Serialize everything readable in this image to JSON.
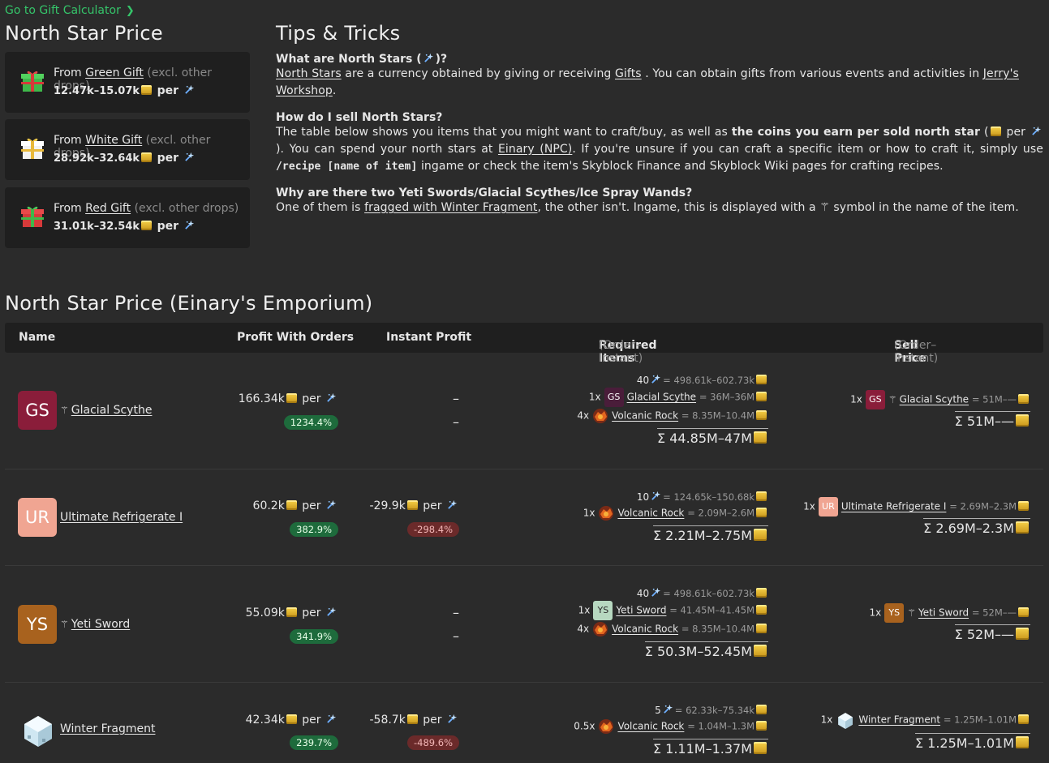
{
  "top_link": "Go to Gift Calculator",
  "left_title": "North Star Price",
  "gifts": [
    {
      "from": "From",
      "name": "Green Gift",
      "excl": "(excl. other drops)",
      "price": "12.47k–15.07k",
      "per": "per",
      "color": "#3fb84a"
    },
    {
      "from": "From",
      "name": "White Gift",
      "excl": "(excl. other drops)",
      "price": "28.92k–32.64k",
      "per": "per",
      "color": "#f2f2f2"
    },
    {
      "from": "From",
      "name": "Red Gift",
      "excl": "(excl. other drops)",
      "price": "31.01k–32.54k",
      "per": "per",
      "color": "#d63a3a"
    }
  ],
  "tips": {
    "title": "Tips & Tricks",
    "q1": "What are North Stars (",
    "q1_end": ")?",
    "a1_link1": "North Stars",
    "a1_t1": " are a currency obtained by giving or receiving ",
    "a1_link2": "Gifts",
    "a1_t2": " . You can obtain gifts from various events and activities in ",
    "a1_link3": "Jerry's Workshop",
    "a1_t3": ".",
    "q2": "How do I sell North Stars?",
    "a2_t1": "The table below shows you items that you might want to craft/buy, as well as ",
    "a2_bold": "the coins you earn per sold north star",
    "a2_t2": " (",
    "a2_per": " per ",
    "a2_t3": "). You can spend your north stars at ",
    "a2_link": "Einary (NPC)",
    "a2_t4": ". If you're unsure if you can craft a specific item or how to craft it, simply use ",
    "a2_code": "/recipe [name of item]",
    "a2_t5": " ingame or check the item's Skyblock Finance and Skyblock Wiki pages for crafting recipes.",
    "q3": "Why are there two Yeti Swords/Glacial Scythes/Ice Spray Wands?",
    "a3_t1": "One of them is ",
    "a3_link": "fragged with Winter Fragment",
    "a3_t2": ", the other isn't. Ingame, this is displayed with a ",
    "a3_sym": "⚚",
    "a3_t3": " symbol in the name of the item."
  },
  "table": {
    "title": "North Star Price (Einary's Emporium)",
    "headers": {
      "name": "Name",
      "profit_orders": "Profit With Orders",
      "instant": "Instant Profit",
      "required": "Required Items",
      "required_sub": "(Order–Instant)",
      "sell": "Sell Price",
      "sell_sub": "(Order–Instant)"
    },
    "per": "per",
    "rows": [
      {
        "abbr": "GS",
        "color": "#8a1d3a",
        "frag": "⚚",
        "name": "Glacial Scythe",
        "profit": "166.34k",
        "profit_pct": "1234.4%",
        "instant": "–",
        "instant_pct": "–",
        "stars": "40",
        "stars_price": "= 498.61k–602.73k",
        "items": [
          {
            "qty": "1x",
            "abbr": "GS",
            "color": "#4a1d3a",
            "name": "Glacial Scythe",
            "price": "= 36M–36M"
          },
          {
            "qty": "4x",
            "rock": true,
            "name": "Volcanic Rock",
            "price": "= 8.35M–10.4M"
          }
        ],
        "sum": "Σ 44.85M–47M",
        "sell_qty": "1x",
        "sell_abbr": "GS",
        "sell_color": "#8a1d3a",
        "sell_frag": "⚚",
        "sell_name": "Glacial Scythe",
        "sell_price": "= 51M–—",
        "sell_sum": "Σ 51M–—"
      },
      {
        "abbr": "UR",
        "color": "#f0a592",
        "frag": "",
        "name": "Ultimate Refrigerate I",
        "profit": "60.2k",
        "profit_pct": "382.9%",
        "instant": "-29.9k",
        "instant_pct": "-298.4%",
        "stars": "10",
        "stars_price": "= 124.65k–150.68k",
        "items": [
          {
            "qty": "1x",
            "rock": true,
            "name": "Volcanic Rock",
            "price": "= 2.09M–2.6M"
          }
        ],
        "sum": "Σ 2.21M–2.75M",
        "sell_qty": "1x",
        "sell_abbr": "UR",
        "sell_color": "#f0a592",
        "sell_frag": "",
        "sell_name": "Ultimate Refrigerate I",
        "sell_price": "= 2.69M–2.3M",
        "sell_sum": "Σ 2.69M–2.3M"
      },
      {
        "abbr": "YS",
        "color": "#a8621e",
        "frag": "⚚",
        "name": "Yeti Sword",
        "profit": "55.09k",
        "profit_pct": "341.9%",
        "instant": "–",
        "instant_pct": "–",
        "stars": "40",
        "stars_price": "= 498.61k–602.73k",
        "items": [
          {
            "qty": "1x",
            "abbr": "YS",
            "color": "#b7d8c0",
            "name": "Yeti Sword",
            "price": "= 41.45M–41.45M"
          },
          {
            "qty": "4x",
            "rock": true,
            "name": "Volcanic Rock",
            "price": "= 8.35M–10.4M"
          }
        ],
        "sum": "Σ 50.3M–52.45M",
        "sell_qty": "1x",
        "sell_abbr": "YS",
        "sell_color": "#a8621e",
        "sell_frag": "⚚",
        "sell_name": "Yeti Sword",
        "sell_price": "= 52M–—",
        "sell_sum": "Σ 52M–—"
      },
      {
        "abbr": "",
        "color": "",
        "frag": "",
        "name": "Winter Fragment",
        "profit": "42.34k",
        "profit_pct": "239.7%",
        "instant": "-58.7k",
        "instant_pct": "-489.6%",
        "stars": "5",
        "stars_price": "= 62.33k–75.34k",
        "items": [
          {
            "qty": "0.5x",
            "rock": true,
            "name": "Volcanic Rock",
            "price": "= 1.04M–1.3M"
          }
        ],
        "sum": "Σ 1.11M–1.37M",
        "sell_qty": "1x",
        "sell_abbr": "",
        "sell_color": "",
        "sell_frag": "",
        "sell_name": "Winter Fragment",
        "sell_price": "= 1.25M–1.01M",
        "sell_sum": "Σ 1.25M–1.01M"
      }
    ]
  }
}
